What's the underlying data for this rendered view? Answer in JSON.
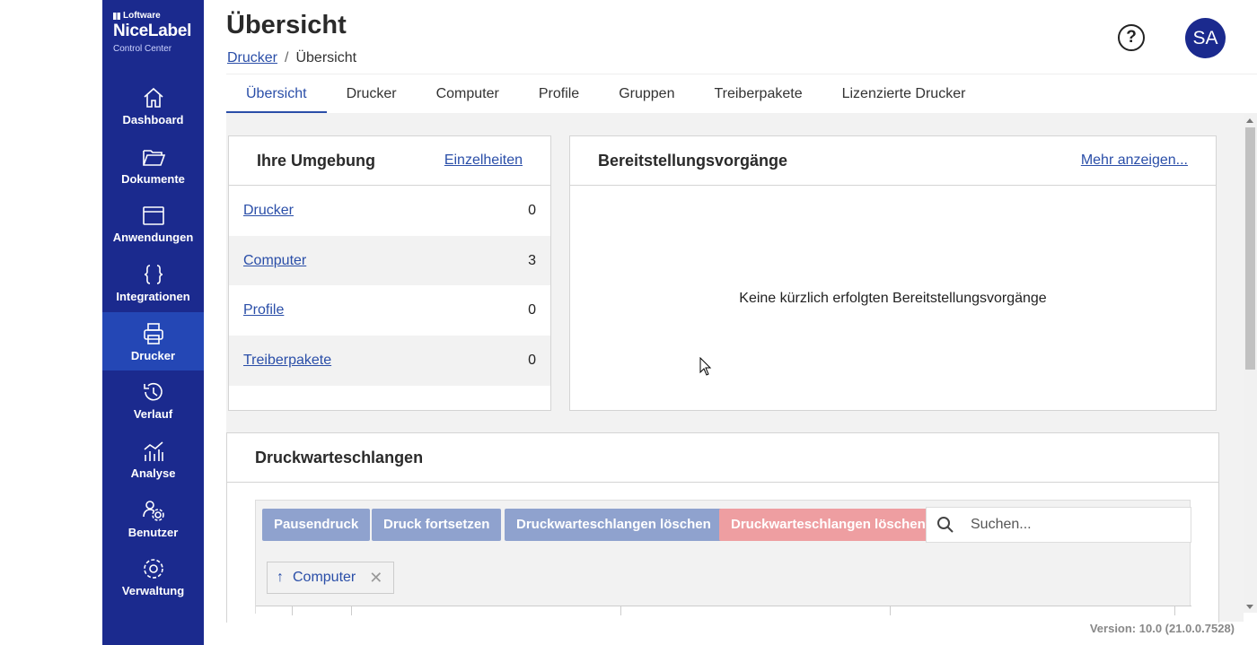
{
  "brand": {
    "company": "Loftware",
    "product": "NiceLabel",
    "subtitle": "Control Center"
  },
  "sidebar": {
    "items": [
      {
        "label": "Dashboard",
        "icon": "home-icon",
        "active": false
      },
      {
        "label": "Dokumente",
        "icon": "folder-icon",
        "active": false
      },
      {
        "label": "Anwendungen",
        "icon": "window-icon",
        "active": false
      },
      {
        "label": "Integrationen",
        "icon": "braces-icon",
        "active": false
      },
      {
        "label": "Drucker",
        "icon": "printer-icon",
        "active": true
      },
      {
        "label": "Verlauf",
        "icon": "history-icon",
        "active": false
      },
      {
        "label": "Analyse",
        "icon": "analytics-icon",
        "active": false
      },
      {
        "label": "Benutzer",
        "icon": "users-icon",
        "active": false
      },
      {
        "label": "Verwaltung",
        "icon": "gear-icon",
        "active": false
      }
    ]
  },
  "header": {
    "title": "Übersicht",
    "breadcrumb": {
      "parent": "Drucker",
      "separator": "/",
      "current": "Übersicht"
    },
    "help": "?",
    "avatar": "SA"
  },
  "tabs": [
    "Übersicht",
    "Drucker",
    "Computer",
    "Profile",
    "Gruppen",
    "Treiberpakete",
    "Lizenzierte Drucker"
  ],
  "environment": {
    "title": "Ihre Umgebung",
    "link": "Einzelheiten",
    "rows": [
      {
        "label": "Drucker",
        "count": "0"
      },
      {
        "label": "Computer",
        "count": "3"
      },
      {
        "label": "Profile",
        "count": "0"
      },
      {
        "label": "Treiberpakete",
        "count": "0"
      }
    ]
  },
  "deployments": {
    "title": "Bereitstellungsvorgänge",
    "link": "Mehr anzeigen...",
    "empty": "Keine kürzlich erfolgten Bereitstellungsvorgänge"
  },
  "queues": {
    "title": "Druckwarteschlangen",
    "buttons": {
      "pause": "Pausendruck",
      "resume": "Druck fortsetzen",
      "clear": "Druckwarteschlangen löschen",
      "delete": "Druckwarteschlangen löschen"
    },
    "search_placeholder": "Suchen...",
    "group_chip": "Computer"
  },
  "version": "Version: 10.0 (21.0.0.7528)",
  "colors": {
    "sidebar": "#1b2a8e",
    "active": "#2447b5",
    "link": "#2a4ea8"
  }
}
